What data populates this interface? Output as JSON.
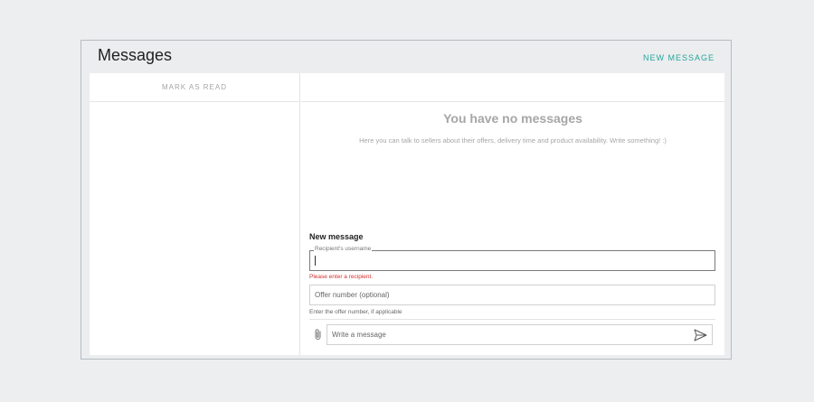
{
  "header": {
    "title": "Messages",
    "new_message_label": "NEW MESSAGE"
  },
  "sidebar": {
    "mark_read_label": "MARK AS READ"
  },
  "empty_state": {
    "title": "You have no messages",
    "description": "Here you can talk to sellers about their offers, delivery time and product availability. Write something! :)"
  },
  "form": {
    "title": "New message",
    "recipient": {
      "label": "Recipient's username",
      "value": "",
      "error": "Please enter a recipient."
    },
    "offer": {
      "placeholder": "Offer number (optional)",
      "hint": "Enter the offer number, if applicable"
    },
    "message": {
      "placeholder": "Write a message"
    }
  },
  "icons": {
    "attach": "paperclip-icon",
    "send": "send-icon"
  },
  "colors": {
    "accent": "#26a69a",
    "error": "#d32f2f",
    "muted_text": "#a6a6a6"
  }
}
